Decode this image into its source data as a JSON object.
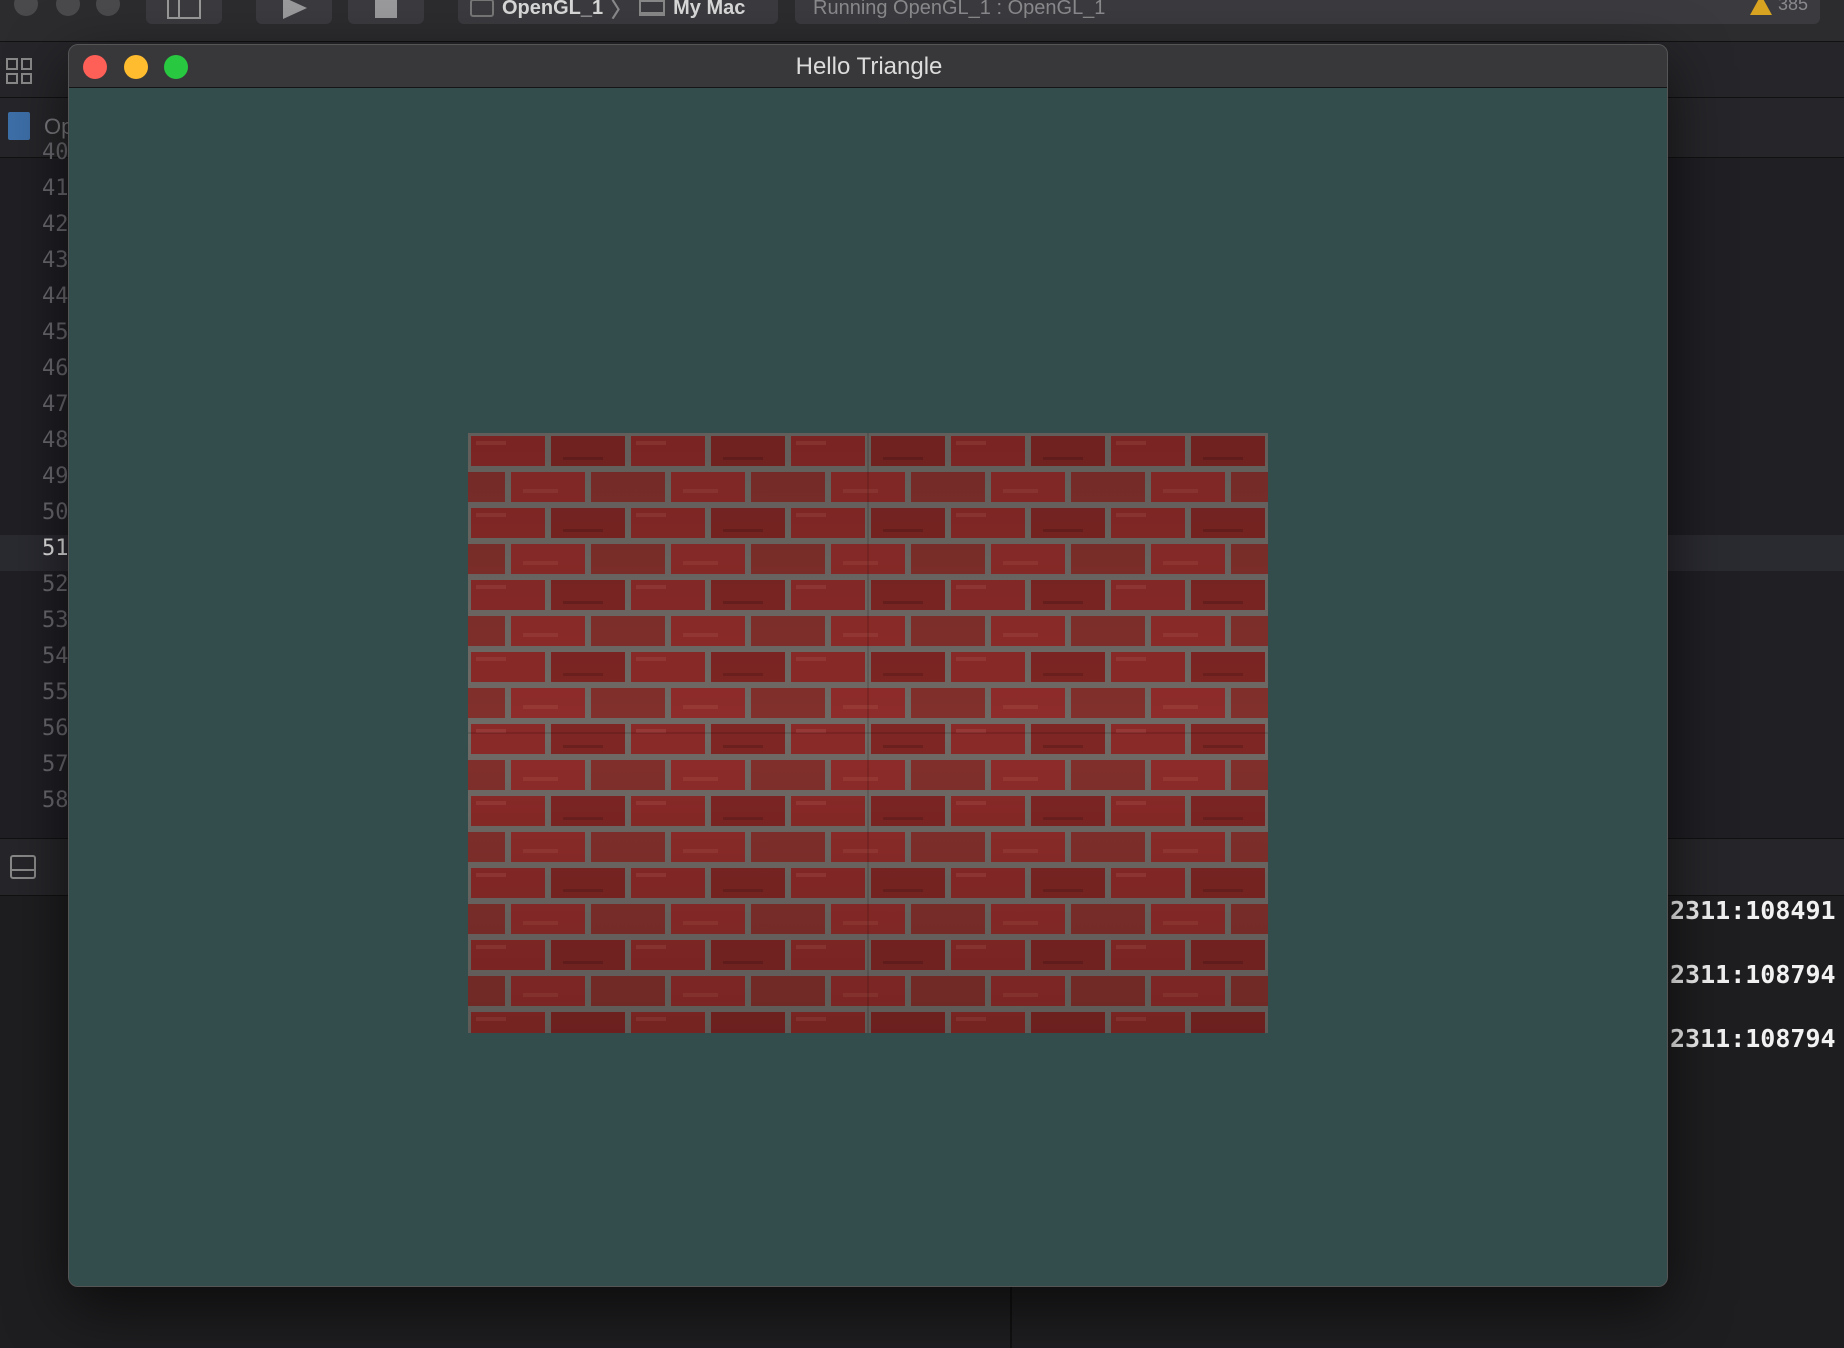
{
  "ide": {
    "scheme": {
      "project": "OpenGL_1",
      "separator": "〉",
      "destination": "My Mac"
    },
    "activity_text": "Running OpenGL_1 : OpenGL_1",
    "warning_count": "385",
    "jump_bar_label": "Op",
    "line_numbers": [
      "40",
      "41",
      "42",
      "43",
      "44",
      "45",
      "46",
      "47",
      "48",
      "49",
      "50",
      "51",
      "52",
      "53",
      "54",
      "55",
      "56",
      "57",
      "58"
    ],
    "current_line": "51",
    "console_lines": [
      "2311:108491",
      "2311:108794",
      "2311:108794"
    ]
  },
  "gl_window": {
    "title": "Hello Triangle",
    "clear_color": "#334c4c",
    "texture": "brick-wall",
    "texture_repeat": "2x2"
  },
  "colors": {
    "brick": "#8a2a28",
    "mortar": "#6f6a66",
    "close": "#fe5f57",
    "minimize": "#febc2e",
    "zoom": "#28c840",
    "warning": "#d8a321"
  }
}
